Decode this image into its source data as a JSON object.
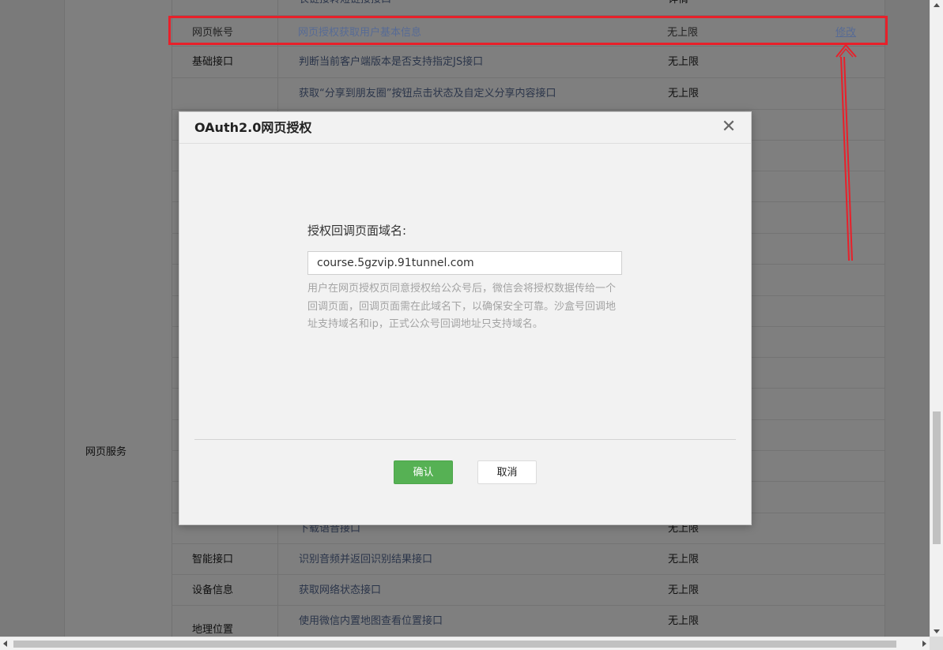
{
  "table": {
    "group_label": "网页服务",
    "rows": [
      {
        "category": "",
        "name": "长链接转短链接接口",
        "limit": "详情"
      },
      {
        "category": "网页帐号",
        "name": "网页授权获取用户基本信息",
        "limit": "无上限"
      },
      {
        "category": "基础接口",
        "name": "判断当前客户端版本是否支持指定JS接口",
        "limit": "无上限"
      },
      {
        "category": "",
        "name": "获取“分享到朋友圈”按钮点击状态及自定义分享内容接口",
        "limit": "无上限"
      },
      {
        "category": "",
        "name": "下载语音接口",
        "limit": "无上限"
      },
      {
        "category": "智能接口",
        "name": "识别音频并返回识别结果接口",
        "limit": "无上限"
      },
      {
        "category": "设备信息",
        "name": "获取网络状态接口",
        "limit": "无上限"
      },
      {
        "category": "地理位置",
        "name": "使用微信内置地图查看位置接口",
        "limit": "无上限"
      }
    ],
    "highlight": {
      "category": "网页帐号",
      "name": "网页授权获取用户基本信息",
      "limit": "无上限",
      "op": "修改"
    }
  },
  "modal": {
    "title": "OAuth2.0网页授权",
    "field_label": "授权回调页面域名:",
    "field_value": "course.5gzvip.91tunnel.com",
    "tip": "用户在网页授权页同意授权给公众号后，微信会将授权数据传给一个回调页面，回调页面需在此域名下，以确保安全可靠。沙盒号回调地址支持域名和ip，正式公众号回调地址只支持域名。",
    "confirm_label": "确认",
    "cancel_label": "取消",
    "close_icon": "close-icon"
  },
  "annotation": {
    "color": "#e8202a"
  },
  "colors": {
    "link": "#576b95",
    "confirm": "#56b154"
  }
}
